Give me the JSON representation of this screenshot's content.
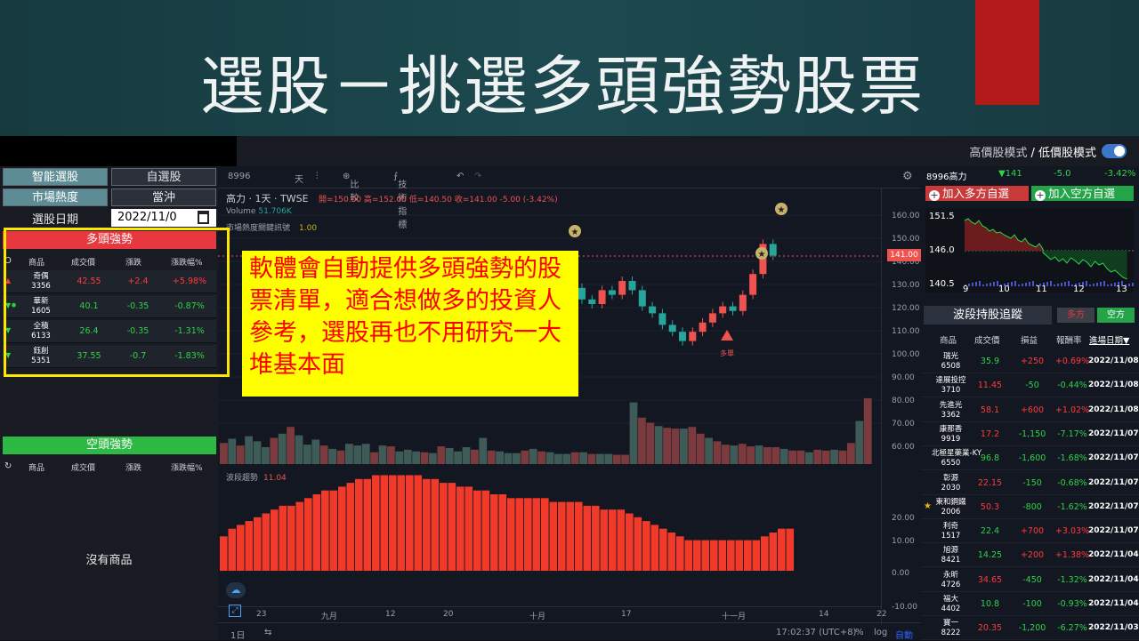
{
  "banner": {
    "title": "選股－挑選多頭強勢股票"
  },
  "top": {
    "mode_high": "高價股模式",
    "mode_sep": " / ",
    "mode_low": "低價股模式"
  },
  "left": {
    "buttons": [
      "智能選股",
      "自選股",
      "市場熱度",
      "當沖"
    ],
    "date_label": "選股日期",
    "date_value": "2022/11/0",
    "long_title": "多頭強勢",
    "short_title": "空頭強勢",
    "columns": [
      "商品",
      "成交價",
      "漲跌",
      "漲跌幅%"
    ],
    "long_rows": [
      {
        "mark": "▲",
        "name": "奇偶",
        "code": "3356",
        "price": "42.55",
        "change": "+2.4",
        "pct": "+5.98%",
        "dir": "up"
      },
      {
        "mark": "▼✹",
        "name": "華新",
        "code": "1605",
        "price": "40.1",
        "change": "-0.35",
        "pct": "-0.87%",
        "dir": "dn"
      },
      {
        "mark": "▼",
        "name": "全積",
        "code": "6133",
        "price": "26.4",
        "change": "-0.35",
        "pct": "-1.31%",
        "dir": "dn"
      },
      {
        "mark": "▼",
        "name": "鈺創",
        "code": "5351",
        "price": "37.55",
        "change": "-0.7",
        "pct": "-1.83%",
        "dir": "dn"
      }
    ],
    "no_items": "沒有商品"
  },
  "chart": {
    "symbol": "8996",
    "toolbar": [
      "天",
      "比較",
      "技術指標"
    ],
    "legend_name": "高力",
    "legend_period": "1天",
    "legend_exchange": "TWSE",
    "ohlc": "開=150.00 高=152.00 低=140.50 收=141.00 -5.00 (-3.42%)",
    "volume_label": "Volume",
    "volume_value": "51.706K",
    "indicator_label": "市場熱度關鍵訊號",
    "indicator_value": "1.00",
    "wave_label": "波段趨勢",
    "wave_value": "11.04",
    "signal_text": "多單",
    "price_tag": "141.00",
    "yticks": [
      "160.00",
      "150.00",
      "140.00",
      "130.00",
      "120.00",
      "110.00",
      "100.00",
      "90.00",
      "80.00",
      "70.00",
      "60.00",
      "20.00",
      "10.00",
      "0.00",
      "-10.00"
    ],
    "xticks": [
      "23",
      "九月",
      "12",
      "20",
      "十月",
      "17",
      "十一月",
      "14",
      "22"
    ],
    "bottom": {
      "period": "1日",
      "time": "17:02:37 (UTC+8)",
      "pct": "%",
      "log": "log",
      "auto": "自動"
    },
    "colors": {
      "up": "#ef5350",
      "down": "#26a69a",
      "bg": "#131722"
    }
  },
  "chart_data": {
    "type": "bar",
    "title": "",
    "candles_visible_from_x": 12,
    "candles": [
      {
        "o": 127,
        "c": 122
      },
      {
        "o": 122,
        "c": 120
      },
      {
        "o": 120,
        "c": 126
      },
      {
        "o": 126,
        "c": 124
      },
      {
        "o": 124,
        "c": 130
      },
      {
        "o": 130,
        "c": 126
      },
      {
        "o": 126,
        "c": 119
      },
      {
        "o": 119,
        "c": 116
      },
      {
        "o": 116,
        "c": 111
      },
      {
        "o": 111,
        "c": 108
      },
      {
        "o": 108,
        "c": 104
      },
      {
        "o": 104,
        "c": 108
      },
      {
        "o": 108,
        "c": 112
      },
      {
        "o": 112,
        "c": 116
      },
      {
        "o": 116,
        "c": 119
      },
      {
        "o": 119,
        "c": 117
      },
      {
        "o": 117,
        "c": 124
      },
      {
        "o": 124,
        "c": 133
      },
      {
        "o": 133,
        "c": 146
      },
      {
        "o": 146,
        "c": 141
      }
    ],
    "volume": [
      25,
      30,
      22,
      33,
      27,
      20,
      31,
      36,
      44,
      34,
      23,
      29,
      22,
      18,
      16,
      24,
      22,
      24,
      14,
      22,
      21,
      15,
      17,
      15,
      14,
      13,
      21,
      19,
      15,
      20,
      17,
      31,
      16,
      15,
      13,
      13,
      16,
      18,
      15,
      14,
      12,
      12,
      14,
      14,
      12,
      12,
      12,
      11,
      11,
      73,
      55,
      49,
      45,
      43,
      42,
      42,
      44,
      36,
      31,
      27,
      23,
      22,
      24,
      21,
      22,
      20,
      20,
      18,
      16,
      16,
      14,
      17,
      16,
      17,
      16,
      25,
      51,
      78
    ],
    "wave": [
      9,
      11,
      12,
      13,
      14,
      15,
      16,
      17,
      17,
      18,
      19,
      20,
      21,
      21,
      22,
      23,
      24,
      24,
      25,
      25,
      25,
      25,
      25,
      25,
      24,
      24,
      23,
      23,
      22,
      22,
      21,
      21,
      20,
      20,
      19,
      19,
      19,
      19,
      19,
      18,
      18,
      18,
      18,
      17,
      17,
      16,
      16,
      16,
      15,
      14,
      13,
      12,
      11,
      10,
      9,
      8,
      8,
      8,
      8,
      8,
      8,
      8,
      8,
      8,
      9,
      10,
      11,
      11
    ]
  },
  "right": {
    "quote": {
      "symbol": "8996高力",
      "price": "▼141",
      "change": "-5.0",
      "pct": "-3.42%"
    },
    "add_long": "加入多方自選",
    "add_short": "加入空方自選",
    "mini_labels": [
      "151.5",
      "146.0",
      "140.5",
      "9",
      "10",
      "11",
      "12",
      "13"
    ],
    "swing_title": "波段持股追蹤",
    "tab_long": "多方",
    "tab_short": "空方",
    "columns": [
      "商品",
      "成交價",
      "損益",
      "報酬率",
      "進場日期▼"
    ],
    "rows": [
      {
        "name": "瑞光",
        "code": "6508",
        "price": "35.9",
        "pl": "+250",
        "rate": "+0.69%",
        "date": "2022/11/08",
        "pd": "dn",
        "pld": "up",
        "star": ""
      },
      {
        "name": "達展投控",
        "code": "3710",
        "price": "11.45",
        "pl": "-50",
        "rate": "-0.44%",
        "date": "2022/11/08",
        "pd": "up",
        "pld": "dn",
        "star": ""
      },
      {
        "name": "先進光",
        "code": "3362",
        "price": "58.1",
        "pl": "+600",
        "rate": "+1.02%",
        "date": "2022/11/08",
        "pd": "up",
        "pld": "up",
        "star": ""
      },
      {
        "name": "康那香",
        "code": "9919",
        "price": "17.2",
        "pl": "-1,150",
        "rate": "-7.17%",
        "date": "2022/11/07",
        "pd": "up",
        "pld": "dn",
        "star": ""
      },
      {
        "name": "北極星藥業-KY",
        "code": "6550",
        "price": "96.8",
        "pl": "-1,600",
        "rate": "-1.68%",
        "date": "2022/11/07",
        "pd": "dn",
        "pld": "dn",
        "star": ""
      },
      {
        "name": "彰源",
        "code": "2030",
        "price": "22.15",
        "pl": "-150",
        "rate": "-0.68%",
        "date": "2022/11/07",
        "pd": "up",
        "pld": "dn",
        "star": ""
      },
      {
        "name": "東和鋼鐵",
        "code": "2006",
        "price": "50.3",
        "pl": "-800",
        "rate": "-1.62%",
        "date": "2022/11/07",
        "pd": "up",
        "pld": "dn",
        "star": "★"
      },
      {
        "name": "利奇",
        "code": "1517",
        "price": "22.4",
        "pl": "+700",
        "rate": "+3.03%",
        "date": "2022/11/07",
        "pd": "dn",
        "pld": "up",
        "star": ""
      },
      {
        "name": "旭源",
        "code": "8421",
        "price": "14.25",
        "pl": "+200",
        "rate": "+1.38%",
        "date": "2022/11/04",
        "pd": "dn",
        "pld": "up",
        "star": ""
      },
      {
        "name": "永昕",
        "code": "4726",
        "price": "34.65",
        "pl": "-450",
        "rate": "-1.32%",
        "date": "2022/11/04",
        "pd": "up",
        "pld": "dn",
        "star": ""
      },
      {
        "name": "福大",
        "code": "4402",
        "price": "10.8",
        "pl": "-100",
        "rate": "-0.93%",
        "date": "2022/11/04",
        "pd": "dn",
        "pld": "dn",
        "star": ""
      },
      {
        "name": "寶一",
        "code": "8222",
        "price": "20.35",
        "pl": "-1,200",
        "rate": "-6.27%",
        "date": "2022/11/03",
        "pd": "up",
        "pld": "dn",
        "star": ""
      }
    ]
  },
  "annotation": {
    "text": "軟體會自動提供多頭強勢的股票清單，適合想做多的投資人參考，選股再也不用研究一大堆基本面"
  }
}
